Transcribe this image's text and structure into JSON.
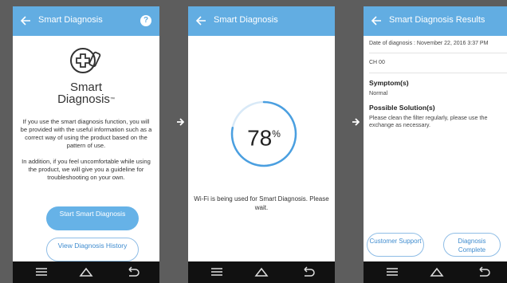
{
  "screen1": {
    "title": "Smart Diagnosis",
    "help_label": "?",
    "logo_line1": "Smart",
    "logo_line2": "Diagnosis",
    "logo_tm": "™",
    "paragraph1": "If you use the smart diagnosis function, you will be provided with the useful information such as a correct way of using the product based on the pattern of use.",
    "paragraph2": "In addition, if you feel uncomfortable while using the product, we will give you a guideline for troubleshooting on your own.",
    "start_button": "Start Smart Diagnosis",
    "history_button": "View Diagnosis History"
  },
  "screen2": {
    "title": "Smart Diagnosis",
    "progress_value": "78",
    "progress_unit": "%",
    "progress_fraction": 0.78,
    "status_text": "Wi-Fi is being used for Smart Diagnosis. Please wait."
  },
  "screen3": {
    "title": "Smart Diagnosis Results",
    "date_label": "Date of diagnosis : November 22, 2016 3:37 PM",
    "code": "CH 00",
    "symptom_heading": "Symptom(s)",
    "symptom_value": "Normal",
    "solution_heading": "Possible Solution(s)",
    "solution_text": "Please clean the filter regularly, please use the exchange as necessary.",
    "support_button": "Customer Support",
    "complete_button": "Diagnosis Complete"
  },
  "colors": {
    "appbar": "#62ade2",
    "accent": "#3f8ccf",
    "background": "#5d5d5d",
    "navbar": "#111111"
  },
  "icons": [
    "back-arrow-icon",
    "help-icon",
    "smart-diagnosis-logo-icon",
    "menu-icon",
    "home-icon",
    "back-icon",
    "flow-arrow-icon"
  ]
}
